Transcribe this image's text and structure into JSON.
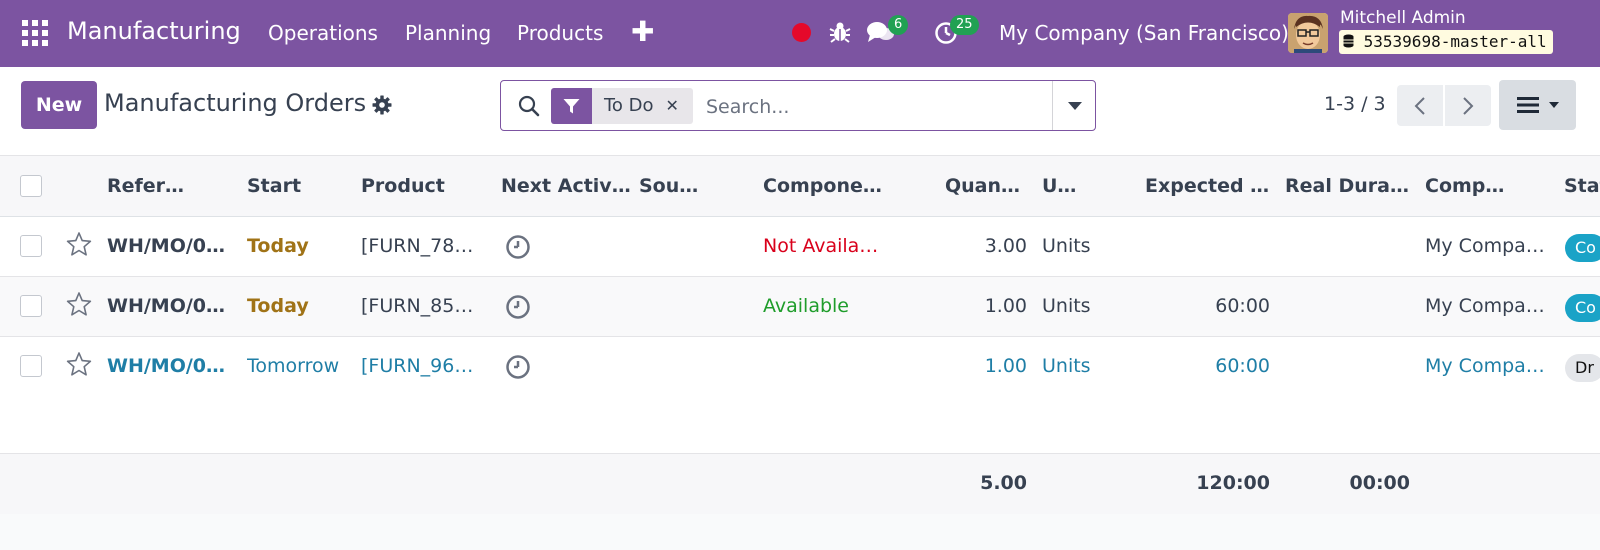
{
  "topbar": {
    "app_name": "Manufacturing",
    "menu": [
      "Operations",
      "Planning",
      "Products"
    ],
    "add_icon": "plus-icon",
    "messages_count": "6",
    "activities_count": "25",
    "company": "My Company (San Francisco)",
    "user_name": "Mitchell Admin",
    "database": "53539698-master-all",
    "colors": {
      "brand": "#7c54a1",
      "badge": "#21a153",
      "record": "#e5092a"
    }
  },
  "control": {
    "new_label": "New",
    "title": "Manufacturing Orders",
    "search": {
      "facet_value": "To Do",
      "placeholder": "Search..."
    },
    "pager": "1-3 / 3"
  },
  "table": {
    "columns": [
      "Refer…",
      "Start",
      "Product",
      "Next Activ…",
      "Sou…",
      "Compone…",
      "Quan…",
      "U…",
      "Expected …",
      "Real Dura…",
      "Comp…",
      "Stat"
    ],
    "rows": [
      {
        "reference": "WH/MO/0…",
        "start": "Today",
        "product": "[FURN_78…",
        "source": "",
        "components": "Not Availa…",
        "quantity": "3.00",
        "uom": "Units",
        "expected": "",
        "real": "",
        "company": "My Compa…",
        "state": "Co"
      },
      {
        "reference": "WH/MO/0…",
        "start": "Today",
        "product": "[FURN_85…",
        "source": "",
        "components": "Available",
        "quantity": "1.00",
        "uom": "Units",
        "expected": "60:00",
        "real": "",
        "company": "My Compa…",
        "state": "Co"
      },
      {
        "reference": "WH/MO/0…",
        "start": "Tomorrow",
        "product": "[FURN_96…",
        "source": "",
        "components": "",
        "quantity": "1.00",
        "uom": "Units",
        "expected": "60:00",
        "real": "",
        "company": "My Compa…",
        "state": "Dr"
      }
    ],
    "totals": {
      "quantity": "5.00",
      "expected": "120:00",
      "real": "00:00"
    },
    "colors": {
      "today": "#a07317",
      "link": "#1f7ea6",
      "not_available": "#d9001b",
      "available": "#1f9d2b",
      "confirmed_badge": "#1aa3c7",
      "draft_badge": "#e4e6ea"
    }
  }
}
